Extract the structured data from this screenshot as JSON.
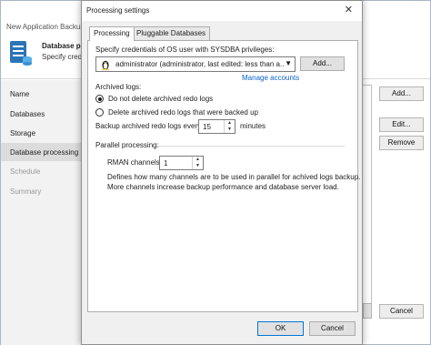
{
  "background_wizard": {
    "window_title": "New Application Backup",
    "header_title": "Database p",
    "header_subtitle": "Specify credenti",
    "steps": [
      "Name",
      "Databases",
      "Storage",
      "Database processing",
      "Schedule",
      "Summary"
    ],
    "buttons": {
      "add": "Add...",
      "edit": "Edit...",
      "remove": "Remove",
      "cancel": "Cancel"
    }
  },
  "dialog": {
    "title": "Processing settings",
    "close_glyph": "✕",
    "tabs": [
      "Processing",
      "Pluggable Databases"
    ],
    "credentials_label": "Specify credentials of OS user with SYSDBA privileges:",
    "credentials_value": "administrator (administrator, last edited: less than a...",
    "credentials_add": "Add...",
    "manage_accounts": "Manage accounts",
    "archived_logs_label": "Archived logs:",
    "radio_do_not_delete": "Do not delete archived redo logs",
    "radio_delete_backed_up": "Delete archived redo logs that were backed up",
    "backup_every_label": "Backup archived redo logs every:",
    "backup_every_value": "15",
    "backup_every_unit": "minutes",
    "parallel_label": "Parallel processing:",
    "rman_label": "RMAN channels:",
    "rman_value": "1",
    "rman_desc_1": "Defines how many channels are to be used in parallel for achived logs backup.",
    "rman_desc_2": "More channels increase backup performance and database server load.",
    "ok": "OK",
    "cancel": "Cancel"
  },
  "colors": {
    "link": "#0a64c8",
    "panel_bg": "#ffffff",
    "dialog_bg": "#f0f0f0"
  }
}
